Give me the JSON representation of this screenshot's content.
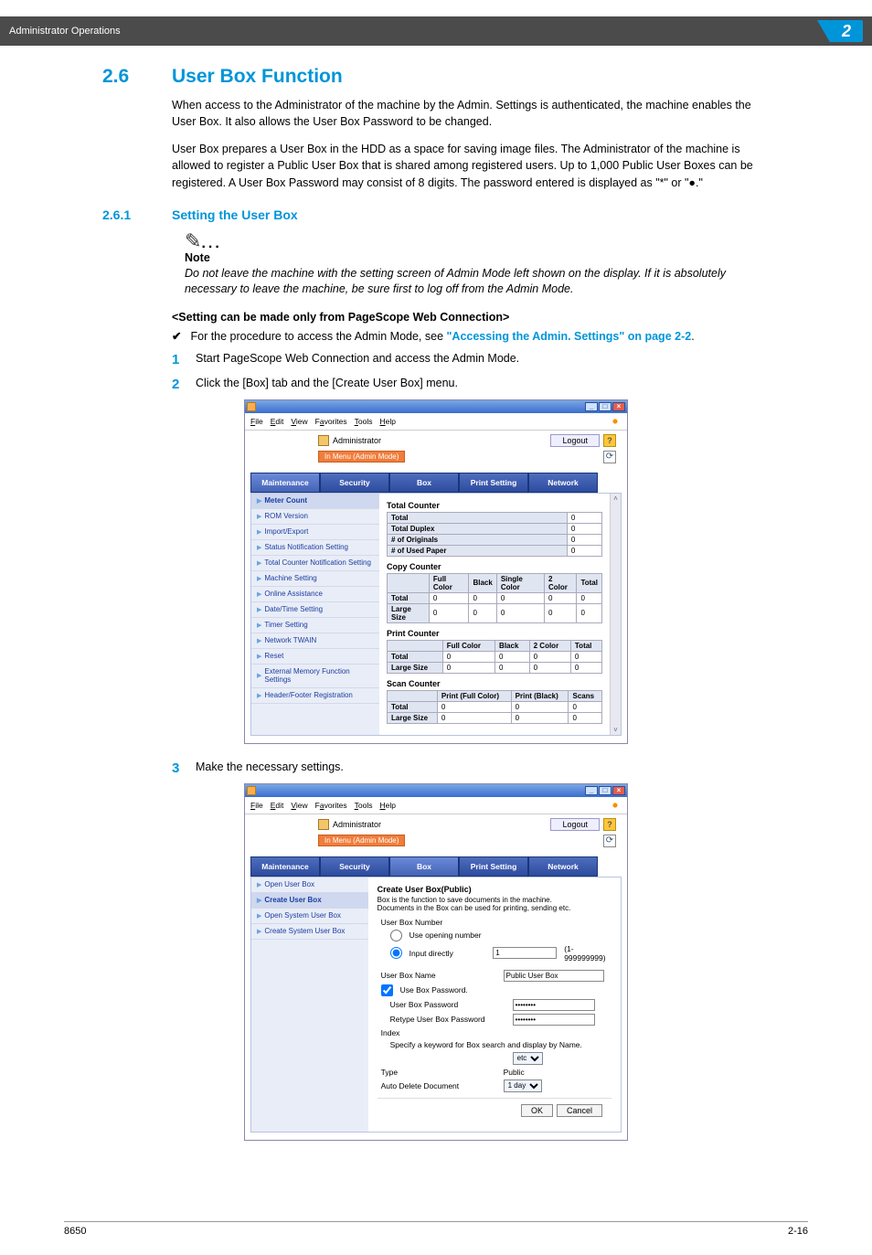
{
  "header": {
    "title": "Administrator Operations",
    "chapter": "2"
  },
  "section": {
    "num": "2.6",
    "title": "User Box Function"
  },
  "para1": "When access to the Administrator of the machine by the Admin. Settings is authenticated, the machine enables the User Box. It also allows the User Box Password to be changed.",
  "para2": "User Box prepares a User Box in the HDD as a space for saving image files. The Administrator of the machine is allowed to register a Public User Box that is shared among registered users. Up to 1,000 Public User Boxes can be registered. A User Box Password may consist of 8 digits. The password entered is displayed as \"*\" or \"●.\"",
  "subsection": {
    "num": "2.6.1",
    "title": "Setting the User Box"
  },
  "note": {
    "label": "Note",
    "body": "Do not leave the machine with the setting screen of Admin Mode left shown on the display. If it is absolutely necessary to leave the machine, be sure first to log off from the Admin Mode."
  },
  "subHeading": "<Setting can be made only from PageScope Web Connection>",
  "checkLine": {
    "prefix": "For the procedure to access the Admin Mode, see ",
    "link": "\"Accessing the Admin. Settings\" on page 2-2",
    "suffix": "."
  },
  "steps": {
    "s1": "Start PageScope Web Connection and access the Admin Mode.",
    "s2": "Click the [Box] tab and the [Create User Box] menu.",
    "s3": "Make the necessary settings."
  },
  "win": {
    "menus": [
      "File",
      "Edit",
      "View",
      "Favorites",
      "Tools",
      "Help"
    ],
    "admin": "Administrator",
    "mode": "In Menu (Admin Mode)",
    "logout": "Logout",
    "tabs": [
      "Maintenance",
      "Security",
      "Box",
      "Print Setting",
      "Network"
    ]
  },
  "shot1": {
    "sidebar": [
      "Meter Count",
      "ROM Version",
      "Import/Export",
      "Status Notification Setting",
      "Total Counter Notification Setting",
      "Machine Setting",
      "Online Assistance",
      "Date/Time Setting",
      "Timer Setting",
      "Network TWAIN",
      "Reset",
      "External Memory Function Settings",
      "Header/Footer Registration"
    ],
    "totalCounter": {
      "label": "Total Counter",
      "rows": [
        [
          "Total",
          "0"
        ],
        [
          "Total Duplex",
          "0"
        ],
        [
          "# of Originals",
          "0"
        ],
        [
          "# of Used Paper",
          "0"
        ]
      ]
    },
    "copyCounter": {
      "label": "Copy Counter",
      "headers": [
        "",
        "Full Color",
        "Black",
        "Single Color",
        "2 Color",
        "Total"
      ],
      "rows": [
        [
          "Total",
          "0",
          "0",
          "0",
          "0",
          "0"
        ],
        [
          "Large Size",
          "0",
          "0",
          "0",
          "0",
          "0"
        ]
      ]
    },
    "printCounter": {
      "label": "Print Counter",
      "headers": [
        "",
        "Full Color",
        "Black",
        "2 Color",
        "Total"
      ],
      "rows": [
        [
          "Total",
          "0",
          "0",
          "0",
          "0"
        ],
        [
          "Large Size",
          "0",
          "0",
          "0",
          "0"
        ]
      ]
    },
    "scanCounter": {
      "label": "Scan Counter",
      "headers": [
        "",
        "Print (Full Color)",
        "Print (Black)",
        "Scans"
      ],
      "rows": [
        [
          "Total",
          "0",
          "0",
          "0"
        ],
        [
          "Large Size",
          "0",
          "0",
          "0"
        ]
      ]
    }
  },
  "shot2": {
    "sidebar": [
      "Open User Box",
      "Create User Box",
      "Open System User Box",
      "Create System User Box"
    ],
    "form": {
      "title": "Create User Box(Public)",
      "desc": "Box is the function to save documents in the machine.\nDocuments in the Box can be used for printing, sending etc.",
      "userBoxNumberLabel": "User Box Number",
      "opt1": "Use opening number",
      "opt2": "Input directly",
      "directValue": "1",
      "directRange": "(1-999999999)",
      "userBoxNameLabel": "User Box Name",
      "userBoxNameValue": "Public User Box",
      "useBoxPwd": "Use Box Password.",
      "pwdLabel": "User Box Password",
      "pwdValue": "********",
      "retypeLabel": "Retype User Box Password",
      "retypeValue": "********",
      "indexLabel": "Index",
      "indexDesc": "Specify a keyword for Box search and display by Name.",
      "indexValue": "etc",
      "typeLabel": "Type",
      "typeValue": "Public",
      "autoDelLabel": "Auto Delete Document",
      "autoDelValue": "1 day",
      "ok": "OK",
      "cancel": "Cancel"
    }
  },
  "footer": {
    "left": "8650",
    "right": "2-16"
  }
}
